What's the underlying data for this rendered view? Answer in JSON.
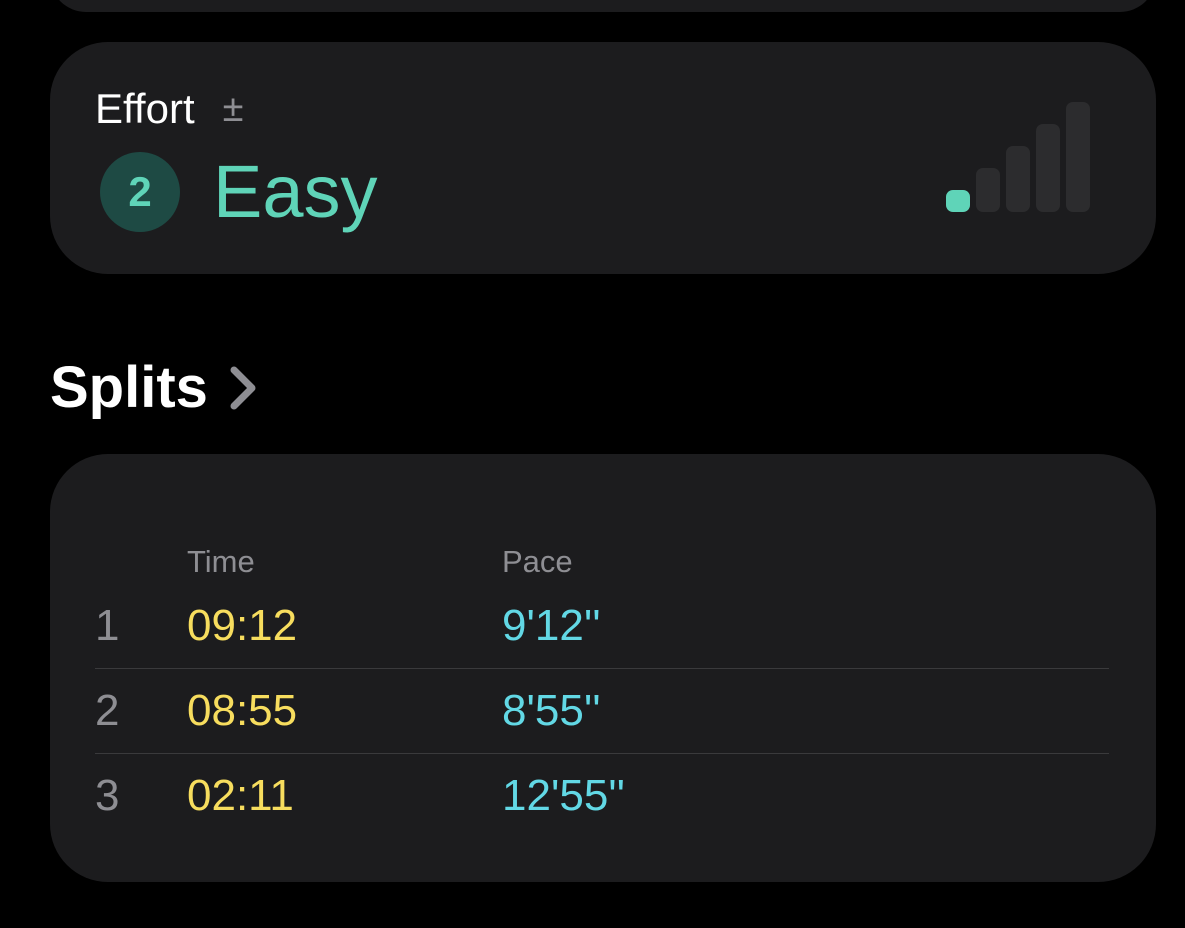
{
  "effort": {
    "label": "Effort",
    "adjust_icon": "plus-minus-icon",
    "level": "2",
    "level_text": "Easy",
    "meter": {
      "icon": "effort-meter-icon",
      "total_bars": 5,
      "filled_bars": 1,
      "active_color": "#5fd4b8",
      "inactive_color": "#2c2c2e"
    }
  },
  "splits": {
    "title": "Splits",
    "chevron_icon": "chevron-right-icon",
    "columns": {
      "time": "Time",
      "pace": "Pace"
    },
    "rows": [
      {
        "index": "1",
        "time": "09:12",
        "pace": "9'12''"
      },
      {
        "index": "2",
        "time": "08:55",
        "pace": "8'55''"
      },
      {
        "index": "3",
        "time": "02:11",
        "pace": "12'55''"
      }
    ]
  },
  "colors": {
    "background": "#000000",
    "card": "#1c1c1e",
    "accent_effort": "#5fd4b8",
    "time": "#f7dd5e",
    "pace": "#62d8e5",
    "secondary_text": "#8e8e93"
  }
}
